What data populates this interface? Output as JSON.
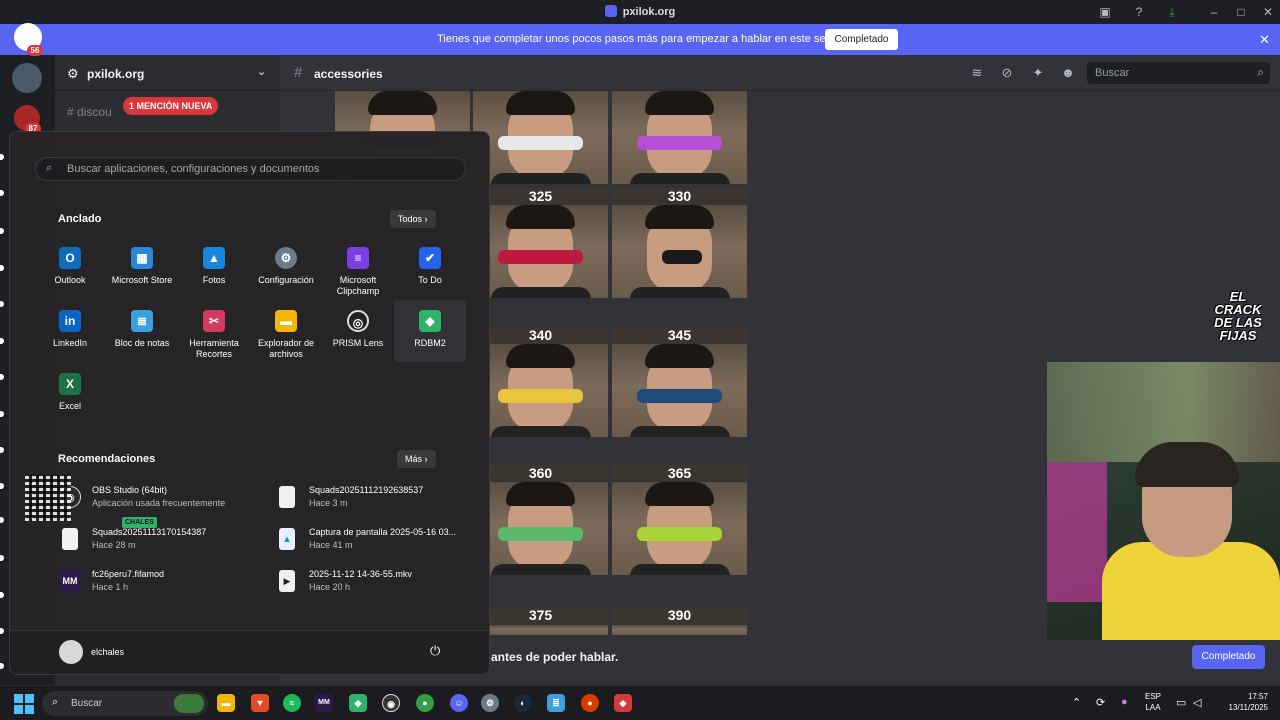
{
  "window": {
    "title": "pxilok.org"
  },
  "notice": {
    "message": "Tienes que completar unos pocos pasos más para empezar a hablar en este servidor.",
    "button": "Completado"
  },
  "rail": {
    "badge_top": "56",
    "badge_second": "87"
  },
  "sidebar": {
    "server_name": "pxilok.org",
    "channel_partial": "discou",
    "mention_pill": "1 MENCIÓN NUEVA"
  },
  "header": {
    "channel": "accessories",
    "search_placeholder": "Buscar"
  },
  "grid": {
    "prices": [
      "325",
      "330",
      "340",
      "345",
      "360",
      "365",
      "375",
      "390"
    ]
  },
  "chat": {
    "gate_text": "antes de poder hablar.",
    "complete_button": "Completado"
  },
  "watermark": {
    "text": "EL CRACK DE LAS FIJAS"
  },
  "start_menu": {
    "search_placeholder": "Buscar aplicaciones, configuraciones y documentos",
    "pinned_title": "Anclado",
    "all_button": "Todos",
    "apps": [
      {
        "label": "Outlook",
        "icon": "outlook-icon",
        "color": "#0f6cbd"
      },
      {
        "label": "Microsoft Store",
        "icon": "store-icon",
        "color": "#2b88d8"
      },
      {
        "label": "Fotos",
        "icon": "photos-icon",
        "color": "#1a86d9"
      },
      {
        "label": "Configuración",
        "icon": "settings-icon",
        "color": "#6b7b8c"
      },
      {
        "label": "Microsoft Clipchamp",
        "icon": "clipchamp-icon",
        "color": "#7b3fe4"
      },
      {
        "label": "To Do",
        "icon": "todo-icon",
        "color": "#2563eb"
      },
      {
        "label": "LinkedIn",
        "icon": "linkedin-icon",
        "color": "#0a66c2"
      },
      {
        "label": "Bloc de notas",
        "icon": "notepad-icon",
        "color": "#3aa0e0"
      },
      {
        "label": "Herramienta Recortes",
        "icon": "snipping-icon",
        "color": "#d23b5f"
      },
      {
        "label": "Explorador de archivos",
        "icon": "folder-icon",
        "color": "#f2b705"
      },
      {
        "label": "PRISM Lens",
        "icon": "prism-icon",
        "color": "#222222"
      },
      {
        "label": "RDBM2",
        "icon": "rdbm-icon",
        "color": "#2fb36a"
      },
      {
        "label": "Excel",
        "icon": "excel-icon",
        "color": "#1e7145"
      }
    ],
    "recommended_title": "Recomendaciones",
    "more_button": "Más",
    "recommendations": [
      {
        "name": "OBS Studio (64bit)",
        "sub": "Aplicación usada frecuentemente",
        "icon": "obs-icon",
        "color": "#2a2a2a"
      },
      {
        "name": "Squads20251112192638537",
        "sub": "Hace 3 m",
        "icon": "file-icon",
        "color": "#f0f0f0"
      },
      {
        "name": "Squads20251113170154387",
        "sub": "Hace 28 m",
        "icon": "file-icon",
        "color": "#f0f0f0"
      },
      {
        "name": "Captura de pantalla 2025-05-16 03...",
        "sub": "Hace 41 m",
        "icon": "image-file-icon",
        "color": "#e8f0ff"
      },
      {
        "name": "fc26peru7.fifamod",
        "sub": "Hace 1 h",
        "icon": "mm-icon",
        "color": "#2a1a4a"
      },
      {
        "name": "2025-11-12 14-36-55.mkv",
        "sub": "Hace 20 h",
        "icon": "video-file-icon",
        "color": "#f0f0f0"
      }
    ],
    "overlay_badge": "CHALES",
    "user": "elchales"
  },
  "taskbar": {
    "search": "Buscar",
    "lang_line1": "ESP",
    "lang_line2": "LAA",
    "time": "17:57",
    "date": "13/11/2025"
  }
}
